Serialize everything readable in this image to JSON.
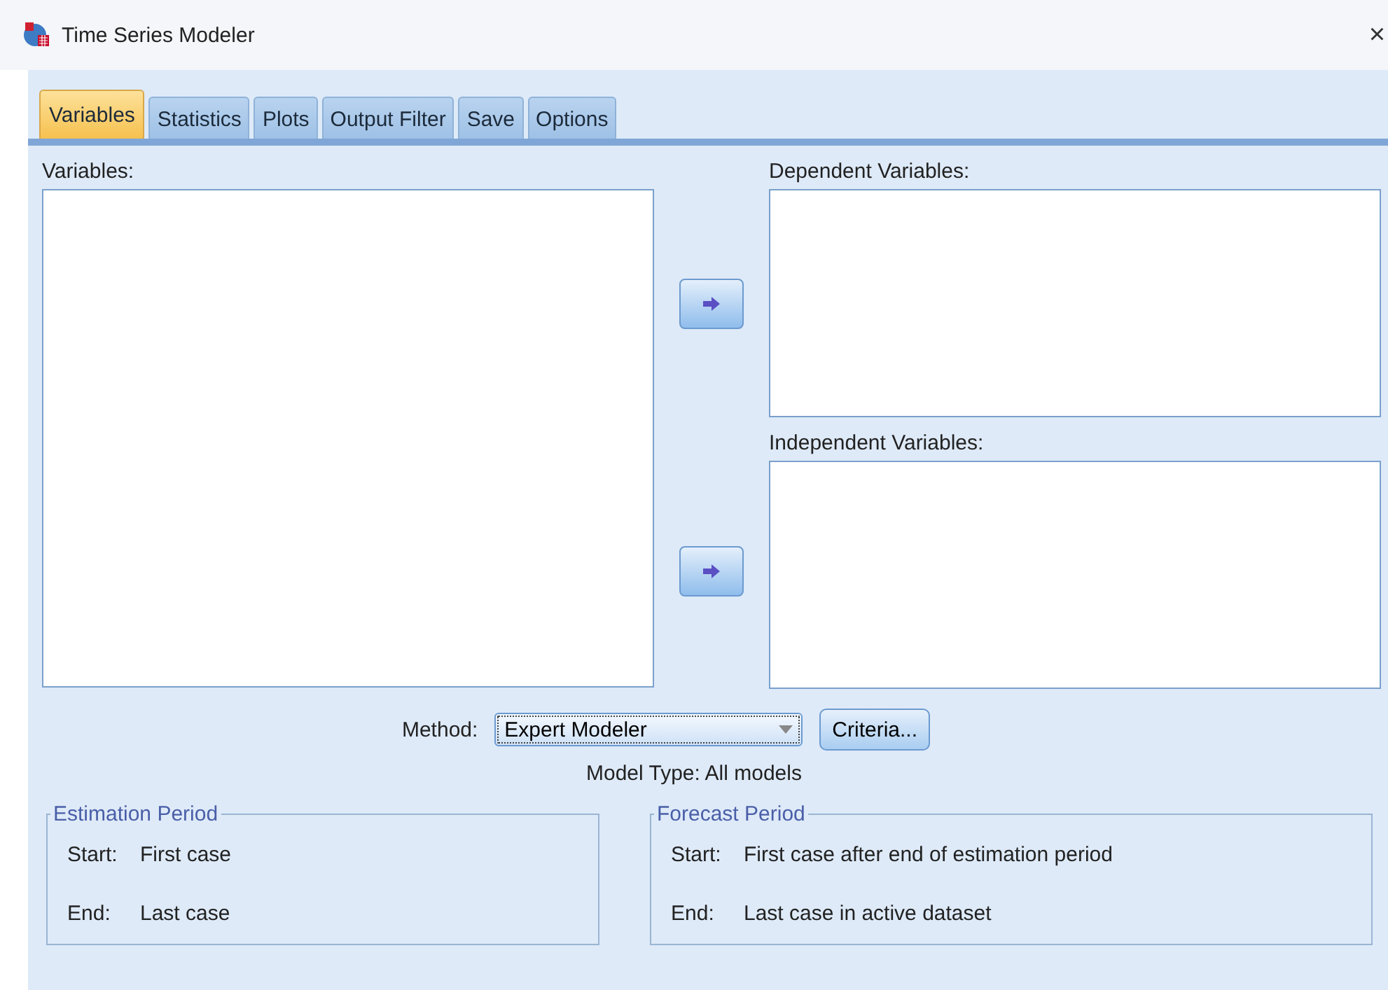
{
  "window": {
    "title": "Time Series Modeler",
    "close": "×"
  },
  "tabs": [
    {
      "label": "Variables",
      "selected": true
    },
    {
      "label": "Statistics",
      "selected": false
    },
    {
      "label": "Plots",
      "selected": false
    },
    {
      "label": "Output Filter",
      "selected": false
    },
    {
      "label": "Save",
      "selected": false
    },
    {
      "label": "Options",
      "selected": false
    }
  ],
  "variables": {
    "label": "Variables:"
  },
  "dependent": {
    "label": "Dependent Variables:"
  },
  "independent": {
    "label": "Independent Variables:"
  },
  "method": {
    "label": "Method:",
    "value": "Expert Modeler",
    "criteria_button": "Criteria...",
    "model_type": "Model Type:  All models"
  },
  "estimation_period": {
    "title": "Estimation Period",
    "start_label": "Start:",
    "start": "First case",
    "end_label": "End:",
    "end": "Last case"
  },
  "forecast_period": {
    "title": "Forecast Period",
    "start_label": "Start:",
    "start": "First case after end of estimation period",
    "end_label": "End:",
    "end": "Last case in active dataset"
  }
}
